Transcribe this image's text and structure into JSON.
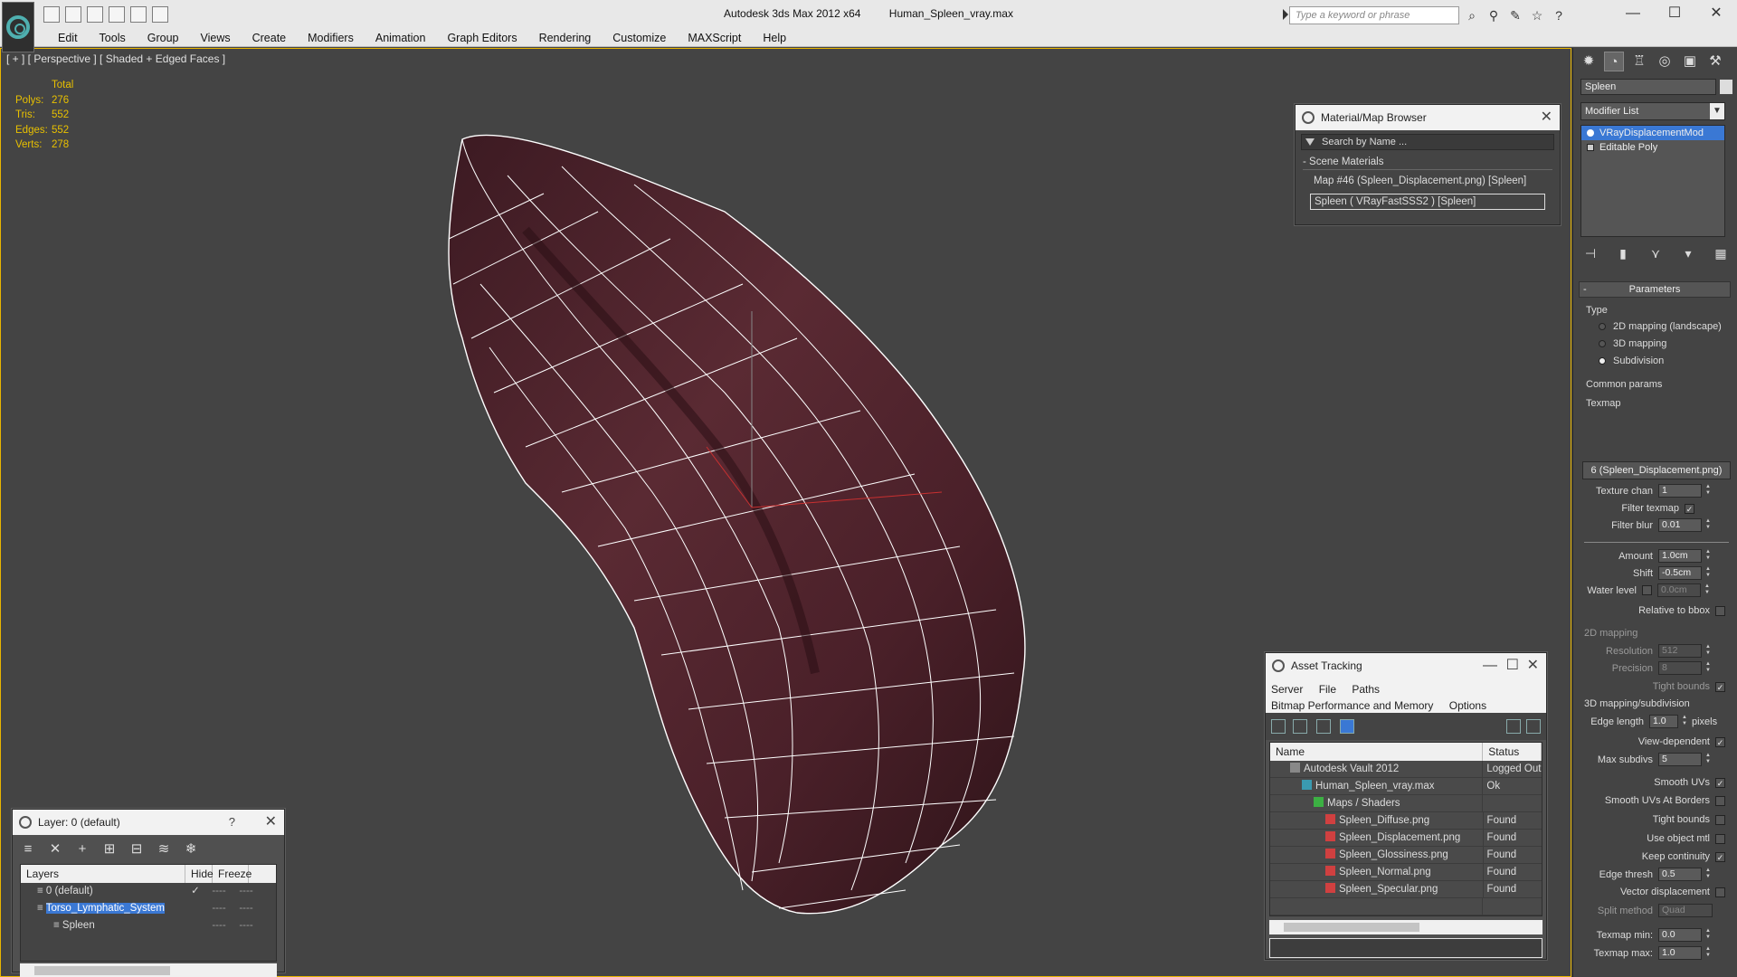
{
  "window": {
    "app_title": "Autodesk 3ds Max  2012 x64",
    "file_title": "Human_Spleen_vray.max",
    "search_placeholder": "Type a keyword or phrase",
    "minimize": "—",
    "maximize": "☐",
    "close": "✕"
  },
  "menu": [
    "Edit",
    "Tools",
    "Group",
    "Views",
    "Create",
    "Modifiers",
    "Animation",
    "Graph Editors",
    "Rendering",
    "Customize",
    "MAXScript",
    "Help"
  ],
  "viewport": {
    "label": "[ + ] [ Perspective ] [ Shaded + Edged Faces ]",
    "stats": {
      "header": "Total",
      "rows": [
        {
          "k": "Polys:",
          "v": "276"
        },
        {
          "k": "Tris:",
          "v": "552"
        },
        {
          "k": "Edges:",
          "v": "552"
        },
        {
          "k": "Verts:",
          "v": "278"
        }
      ]
    }
  },
  "material_browser": {
    "title": "Material/Map Browser",
    "search_placeholder": "Search by Name ...",
    "section": "Scene Materials",
    "items": [
      "Map #46 (Spleen_Displacement.png)  [Spleen]",
      "Spleen  ( VRayFastSSS2 )  [Spleen]"
    ]
  },
  "asset_tracking": {
    "title": "Asset Tracking",
    "menu": [
      "Server",
      "File",
      "Paths",
      "Bitmap Performance and Memory",
      "Options"
    ],
    "columns": [
      "Name",
      "Status"
    ],
    "rows": [
      {
        "name": "Autodesk Vault 2012",
        "status": "Logged Out",
        "indent": 0,
        "icon": "vault-icon"
      },
      {
        "name": "Human_Spleen_vray.max",
        "status": "Ok",
        "indent": 1,
        "icon": "max-file-icon"
      },
      {
        "name": "Maps / Shaders",
        "status": "",
        "indent": 2,
        "icon": "maps-folder-icon"
      },
      {
        "name": "Spleen_Diffuse.png",
        "status": "Found",
        "indent": 3,
        "icon": "png-icon"
      },
      {
        "name": "Spleen_Displacement.png",
        "status": "Found",
        "indent": 3,
        "icon": "png-icon"
      },
      {
        "name": "Spleen_Glossiness.png",
        "status": "Found",
        "indent": 3,
        "icon": "png-icon"
      },
      {
        "name": "Spleen_Normal.png",
        "status": "Found",
        "indent": 3,
        "icon": "png-icon"
      },
      {
        "name": "Spleen_Specular.png",
        "status": "Found",
        "indent": 3,
        "icon": "png-icon"
      }
    ]
  },
  "layer_panel": {
    "title": "Layer: 0 (default)",
    "help": "?",
    "columns": [
      "Layers",
      "Hide",
      "Freeze"
    ],
    "rows": [
      {
        "name": "0 (default)",
        "check": "✓",
        "selected": false,
        "indent": 1
      },
      {
        "name": "Torso_Lymphatic_System",
        "check": "",
        "selected": true,
        "indent": 1
      },
      {
        "name": "Spleen",
        "check": "",
        "selected": false,
        "indent": 2
      }
    ],
    "dash": "----"
  },
  "command_panel": {
    "object_name": "Spleen",
    "modifier_list": "Modifier List",
    "stack": [
      "VRayDisplacementMod",
      "Editable Poly"
    ],
    "rollout_title": "Parameters",
    "rollout_minus": "-",
    "type_label": "Type",
    "type_options": [
      {
        "label": "2D mapping (landscape)",
        "on": false
      },
      {
        "label": "3D mapping",
        "on": false
      },
      {
        "label": "Subdivision",
        "on": true
      }
    ],
    "common_params": "Common params",
    "texmap_label": "Texmap",
    "texmap_value": "6 (Spleen_Displacement.png)",
    "texture_chan_label": "Texture chan",
    "texture_chan": "1",
    "filter_texmap": "Filter texmap",
    "filter_blur_label": "Filter blur",
    "filter_blur": "0.01",
    "amount_label": "Amount",
    "amount": "1.0cm",
    "shift_label": "Shift",
    "shift": "-0.5cm",
    "water_level_label": "Water level",
    "water_level": "0.0cm",
    "relative_bbox": "Relative to bbox",
    "mapping2d": "2D mapping",
    "resolution_label": "Resolution",
    "resolution": "512",
    "precision_label": "Precision",
    "precision": "8",
    "tight_bounds_2d": "Tight bounds",
    "mapping3d": "3D mapping/subdivision",
    "edge_length_label": "Edge length",
    "edge_length": "1.0",
    "pixels": "pixels",
    "view_dependent": "View-dependent",
    "max_subdivs_label": "Max subdivs",
    "max_subdivs": "5",
    "smooth_uvs": "Smooth UVs",
    "smooth_uvs_borders": "Smooth UVs At Borders",
    "tight_bounds": "Tight bounds",
    "use_object_mtl": "Use object mtl",
    "keep_continuity": "Keep continuity",
    "edge_thresh_label": "Edge thresh",
    "edge_thresh": "0.5",
    "vector_displacement": "Vector displacement",
    "split_method_label": "Split method",
    "split_method": "Quad",
    "texmap_min_label": "Texmap min:",
    "texmap_min": "0.0",
    "texmap_max_label": "Texmap max:",
    "texmap_max": "1.0",
    "check": "✓"
  }
}
